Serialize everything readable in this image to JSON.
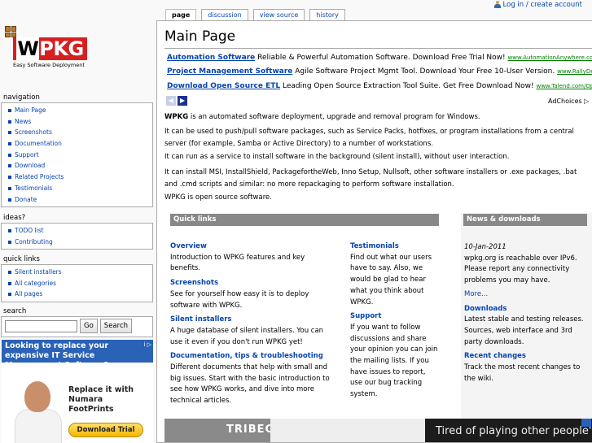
{
  "personal": {
    "login_label": "Log in / create account"
  },
  "tabs": [
    {
      "label": "page",
      "selected": true
    },
    {
      "label": "discussion",
      "selected": false
    },
    {
      "label": "view source",
      "selected": false
    },
    {
      "label": "history",
      "selected": false
    }
  ],
  "logo": {
    "wordmark_w": "W",
    "wordmark_rest": "PKG",
    "tagline": "Easy Software Deployment"
  },
  "sidebar": {
    "navigation": {
      "title": "navigation",
      "items": [
        "Main Page",
        "News",
        "Screenshots",
        "Documentation",
        "Support",
        "Download",
        "Related Projects",
        "Testimonials",
        "Donate"
      ]
    },
    "ideas": {
      "title": "ideas?",
      "items": [
        "TODO list",
        "Contributing"
      ]
    },
    "quicklinks": {
      "title": "quick links",
      "items": [
        "Silent installers",
        "All categories",
        "All pages"
      ]
    },
    "search": {
      "title": "search",
      "value": "",
      "go_label": "Go",
      "search_label": "Search"
    }
  },
  "left_ad": {
    "headline": "Looking to replace your expensive IT Service Management Software?",
    "copy": "Replace it with Numara FootPrints",
    "button": "Download Trial",
    "ad_icons": "i ▷"
  },
  "main": {
    "title": "Main Page",
    "ads": [
      {
        "title": "Automation Software",
        "text": "Reliable & Powerful Automation Software. Download Free Trial Now!",
        "url": "www.AutomationAnywhere.com"
      },
      {
        "title": "Project Management Software",
        "text": "Agile Software Project Mgmt Tool. Download Your Free 10-User Version.",
        "url": "www.RallyDev.com"
      },
      {
        "title": "Download Open Source ETL",
        "text": "Leading Open Source Extraction Tool Suite. Get Free Download Now!",
        "url": "www.Talend.com/Open_Sou"
      }
    ],
    "ad_choices": "AdChoices ▷",
    "intro_bold": "WPKG",
    "intro_rest": " is an automated software deployment, upgrade and removal program for Windows.",
    "p2": "It can be used to push/pull software packages, such as Service Packs, hotfixes, or program installations from a central server (for example, Samba or Active Directory) to a number of workstations.",
    "p3": "It can run as a service to install software in the background (silent install), without user interaction.",
    "p4": "It can install MSI, InstallShield, PackagefortheWeb, Inno Setup, Nullsoft, other software installers or .exe packages, .bat and .cmd scripts and similar: no more repackaging to perform software installation.",
    "p5": "WPKG is open source software."
  },
  "quick_links": {
    "title": "Quick links",
    "left": [
      {
        "heading": "Overview",
        "text": "Introduction to WPKG features and key benefits."
      },
      {
        "heading": "Screenshots",
        "text": "See for yourself how easy it is to deploy software with WPKG."
      },
      {
        "heading": "Silent installers",
        "text": "A huge database of silent installers. You can use it even if you don't run WPKG yet!"
      },
      {
        "heading": "Documentation, tips & troubleshooting",
        "text": "Different documents that help with small and big issues. Start with the basic introduction to see how WPKG works, and dive into more technical articles."
      }
    ],
    "right": [
      {
        "heading": "Testimonials",
        "text": "Find out what our users have to say. Also, we would be glad to hear what you think about WPKG."
      },
      {
        "heading": "Support",
        "text": "If you want to follow discussions and share your opinion you can join the mailing lists. If you have issues to report, use our bug tracking system."
      }
    ]
  },
  "news": {
    "title": "News & downloads",
    "date": "10-Jan-2011",
    "text": "wpkg.org is reachable over IPv6. Please report any connectivity problems you may have.",
    "more": "More...",
    "downloads_heading": "Downloads",
    "downloads_text": "Latest stable and testing releases. Sources, web interface and 3rd party downloads.",
    "changes_heading": "Recent changes",
    "changes_text": "Track the most recent changes to the wiki."
  },
  "bottom_ad": {
    "brand": "TRIBECA",
    "text": "Tired of playing other people's"
  }
}
